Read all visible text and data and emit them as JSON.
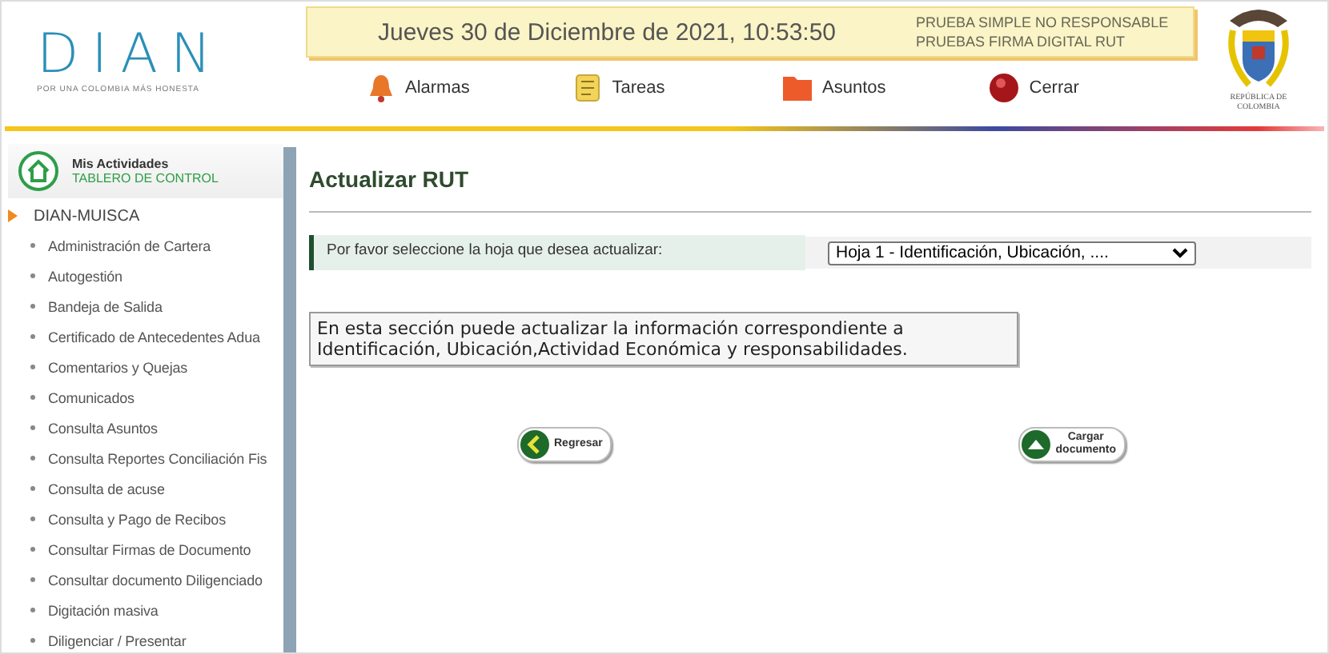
{
  "header": {
    "logo": {
      "text": "DIAN",
      "slogan": "POR UNA COLOMBIA MÁS HONESTA"
    },
    "date_bar": {
      "datetime": "Jueves 30 de Diciembre de 2021, 10:53:50",
      "lines": [
        "PRUEBA SIMPLE NO RESPONSABLE",
        "PRUEBAS FIRMA DIGITAL RUT"
      ]
    },
    "nav": [
      {
        "kind": "alarm",
        "label": "Alarmas"
      },
      {
        "kind": "tasks",
        "label": "Tareas"
      },
      {
        "kind": "folder",
        "label": "Asuntos"
      },
      {
        "kind": "close",
        "label": "Cerrar"
      }
    ],
    "emblem_caption": "REPÚBLICA DE COLOMBIA"
  },
  "sidebar": {
    "title": "Mis Actividades",
    "subtitle": "TABLERO DE CONTROL",
    "tree": [
      {
        "label": "DIAN-MUISCA",
        "expanded": true,
        "children": [
          {
            "label": "Administración de Cartera"
          },
          {
            "label": "Autogestión"
          },
          {
            "label": "Bandeja de Salida"
          },
          {
            "label": "Certificado de Antecedentes Adua"
          },
          {
            "label": "Comentarios y Quejas"
          },
          {
            "label": "Comunicados"
          },
          {
            "label": "Consulta Asuntos"
          },
          {
            "label": "Consulta Reportes Conciliación Fis"
          },
          {
            "label": "Consulta de acuse"
          },
          {
            "label": "Consulta y Pago de Recibos"
          },
          {
            "label": "Consultar Firmas de Documento"
          },
          {
            "label": "Consultar documento Diligenciado"
          },
          {
            "label": "Digitación masiva"
          },
          {
            "label": "Diligenciar / Presentar"
          }
        ]
      }
    ]
  },
  "main": {
    "title": "Actualizar RUT",
    "prompt": "Por favor seleccione la hoja que desea actualizar:",
    "sheet_select": {
      "value": "Hoja 1 - Identificación, Ubicación, ...."
    },
    "info": [
      "En esta sección puede actualizar la información correspondiente a",
      "Identificación, Ubicación,Actividad Económica y responsabilidades."
    ],
    "buttons": [
      {
        "kind": "back",
        "label": [
          "Regresar"
        ]
      },
      {
        "kind": "upload",
        "label": [
          "Cargar",
          "documento"
        ]
      }
    ]
  }
}
